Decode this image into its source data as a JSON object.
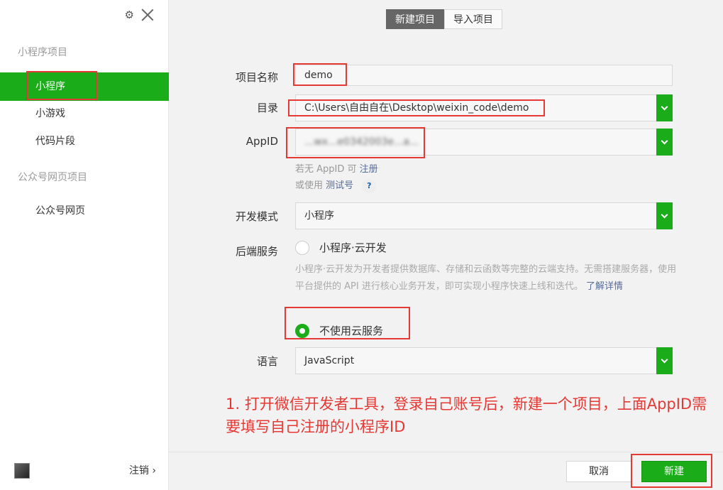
{
  "sidebar": {
    "sections": [
      {
        "title": "小程序项目",
        "items": [
          "小程序",
          "小游戏",
          "代码片段"
        ]
      },
      {
        "title": "公众号网页项目",
        "items": [
          "公众号网页"
        ]
      }
    ],
    "active_item": "小程序",
    "logout_label": "注销"
  },
  "tabs": [
    "新建项目",
    "导入项目"
  ],
  "active_tab": "新建项目",
  "form": {
    "project_name": {
      "label": "项目名称",
      "value": "demo"
    },
    "directory": {
      "label": "目录",
      "value": "C:\\Users\\自由自在\\Desktop\\weixin_code\\demo"
    },
    "appid": {
      "label": "AppID",
      "value": "...wx...e0342003e...a...",
      "hint_no_appid_prefix": "若无 AppID 可",
      "hint_register": "注册",
      "hint_or_use": "或使用",
      "hint_test_account": "测试号",
      "hint_help": "?"
    },
    "dev_mode": {
      "label": "开发模式",
      "value": "小程序"
    },
    "backend": {
      "label": "后端服务",
      "option_cloud": "小程序·云开发",
      "cloud_desc": "小程序·云开发为开发者提供数据库、存储和云函数等完整的云端支持。无需搭建服务器，使用平台提供的 API 进行核心业务开发，即可实现小程序快速上线和迭代。",
      "learn_more": "了解详情",
      "option_none": "不使用云服务",
      "selected": "不使用云服务"
    },
    "language": {
      "label": "语言",
      "value": "JavaScript"
    }
  },
  "annotation": "1. 打开微信开发者工具，登录自己账号后，新建一个项目，上面AppID需要填写自己注册的小程序ID",
  "footer": {
    "cancel_label": "取消",
    "create_label": "新建"
  },
  "colors": {
    "accent": "#1aad19",
    "annotation": "#e53935"
  }
}
